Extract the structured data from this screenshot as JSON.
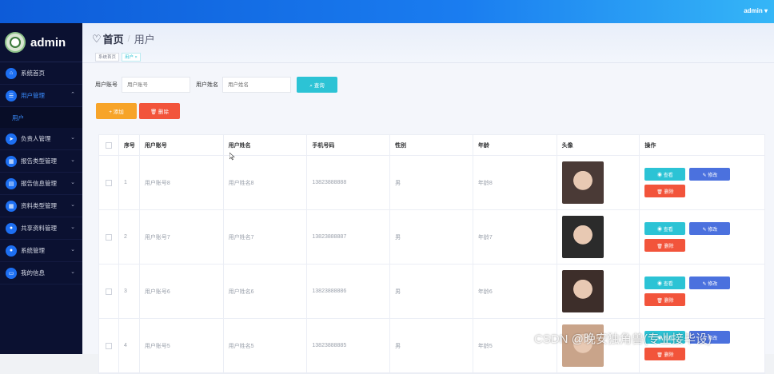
{
  "topbar": {
    "user": "admin ▾"
  },
  "brand": {
    "name": "admin"
  },
  "sidebar": {
    "items": [
      {
        "label": "系统首页",
        "icon": "home-icon",
        "glyph": "⌂",
        "chevron": ""
      },
      {
        "label": "用户管理",
        "icon": "user-group-icon",
        "glyph": "☰",
        "chevron": "⌃",
        "active": true
      },
      {
        "label": "负责人管理",
        "icon": "send-icon",
        "glyph": "➤",
        "chevron": "⌄"
      },
      {
        "label": "报告类型管理",
        "icon": "grid-icon",
        "glyph": "▦",
        "chevron": "⌄"
      },
      {
        "label": "报告信息管理",
        "icon": "document-icon",
        "glyph": "▤",
        "chevron": "⌄"
      },
      {
        "label": "资料类型管理",
        "icon": "grid-icon",
        "glyph": "▦",
        "chevron": "⌄"
      },
      {
        "label": "共享资料管理",
        "icon": "user-icon",
        "glyph": "●",
        "chevron": "⌄"
      },
      {
        "label": "系统管理",
        "icon": "user-icon",
        "glyph": "●",
        "chevron": "⌄"
      },
      {
        "label": "我的信息",
        "icon": "id-card-icon",
        "glyph": "▭",
        "chevron": "⌄"
      }
    ],
    "submenu": "用户"
  },
  "breadcrumb": {
    "home": "首页",
    "separator": "/",
    "current": "用户"
  },
  "tags": [
    {
      "label": "系统首页"
    },
    {
      "label": "用户 ×"
    }
  ],
  "search": {
    "account_label": "用户账号",
    "account_placeholder": "用户账号",
    "name_label": "用户姓名",
    "name_placeholder": "用户姓名",
    "query_button": "⌕ 查询"
  },
  "actions": {
    "add": "+ 添加",
    "delete": "🗑 删除"
  },
  "table": {
    "headers": [
      "序号",
      "用户账号",
      "用户姓名",
      "手机号码",
      "性别",
      "年龄",
      "头像",
      "操作"
    ],
    "rows": [
      {
        "no": "1",
        "account": "用户账号8",
        "name": "用户姓名8",
        "phone": "13823888888",
        "gender": "男",
        "age": "年龄8",
        "photo_color": "#4a3a36"
      },
      {
        "no": "2",
        "account": "用户账号7",
        "name": "用户姓名7",
        "phone": "13823888887",
        "gender": "男",
        "age": "年龄7",
        "photo_color": "#2b2b2b"
      },
      {
        "no": "3",
        "account": "用户账号6",
        "name": "用户姓名6",
        "phone": "13823888886",
        "gender": "男",
        "age": "年龄6",
        "photo_color": "#3d2e2a"
      },
      {
        "no": "4",
        "account": "用户账号5",
        "name": "用户姓名5",
        "phone": "13823888885",
        "gender": "男",
        "age": "年龄5",
        "photo_color": "#c9a48a"
      }
    ],
    "ops": {
      "view": "◉ 查看",
      "edit": "✎ 修改",
      "delete": "🗑 删除"
    }
  },
  "watermark": "CSDN @晚安独角兽(专业接毕设)",
  "colors": {
    "accent": "#2cc3d5",
    "primary": "#4b71de",
    "danger": "#f2543b",
    "warning": "#f7a429",
    "sidebar": "#0b1131"
  }
}
